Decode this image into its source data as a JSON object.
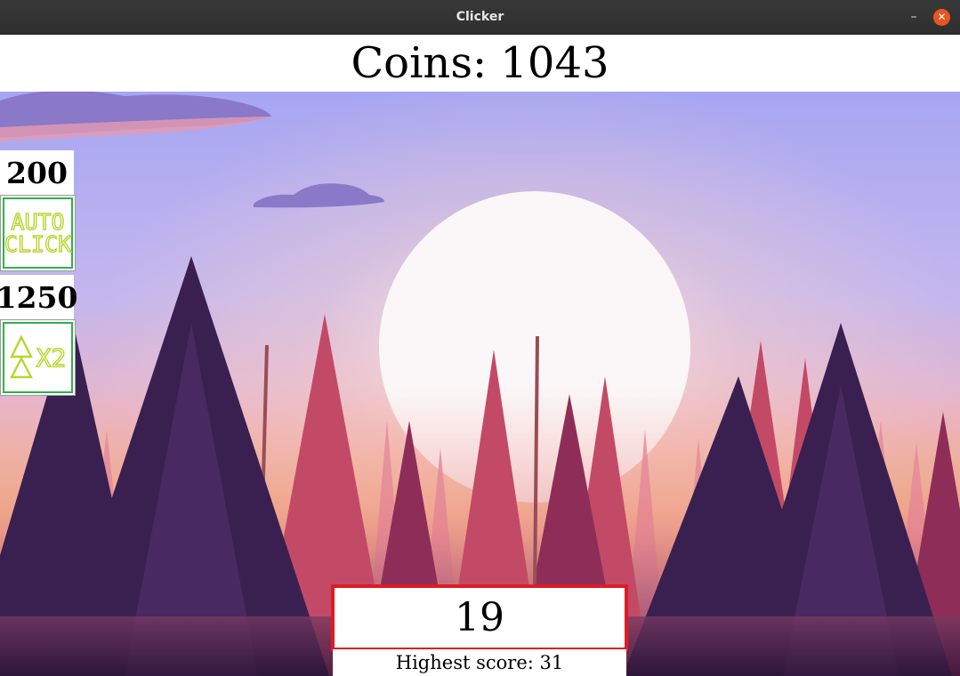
{
  "window": {
    "title": "Clicker",
    "minimize_glyph": "–",
    "close_glyph": "✕"
  },
  "coins": {
    "label": "Coins: 1043"
  },
  "shop": {
    "autoclick": {
      "price": "200",
      "label_line1": "AUTO",
      "label_line2": "CLICK",
      "icon": "autoclick-icon"
    },
    "multiplier": {
      "price": "1250",
      "label": "X2",
      "icon": "tree-icon"
    }
  },
  "clicker": {
    "value": "19"
  },
  "highscore": {
    "label": "Highest score: 31"
  },
  "colors": {
    "accent_red": "#e01b24",
    "shop_border_green": "#2fb14a",
    "shop_text_lime": "#b7d62c",
    "close_orange": "#e95420"
  }
}
